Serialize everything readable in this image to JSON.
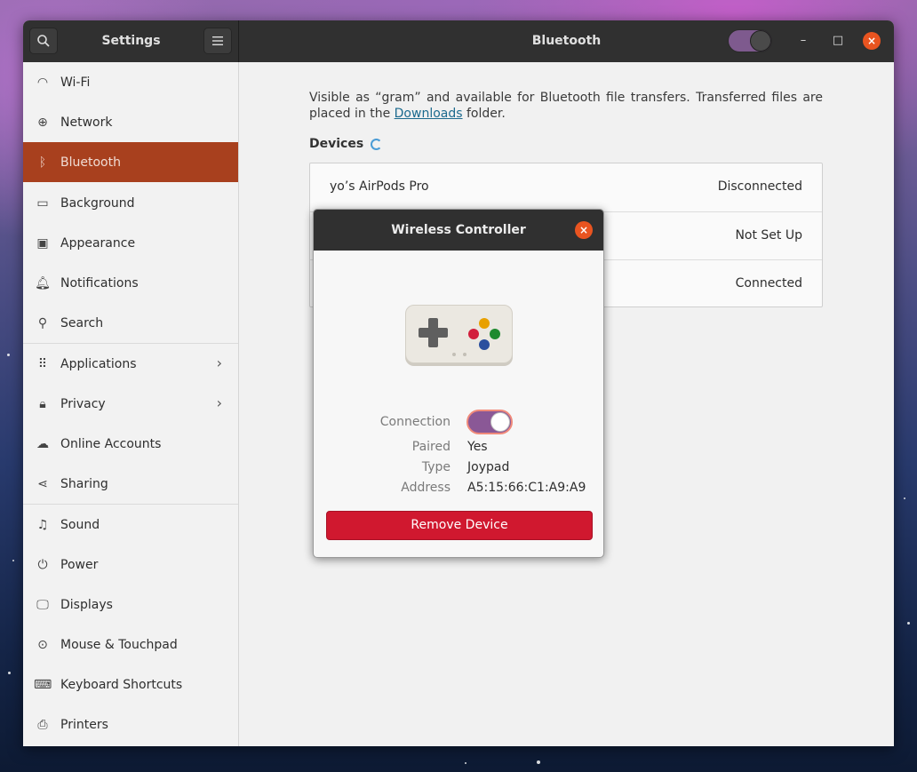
{
  "window": {
    "sidebar_title": "Settings",
    "page_title": "Bluetooth",
    "search_icon": "search-icon",
    "menu_icon": "hamburger-menu-icon",
    "bluetooth_enabled": true,
    "controls": {
      "minimize": "–",
      "maximize": "□",
      "close": "×"
    }
  },
  "sidebar": {
    "items": [
      {
        "label": "Wi-Fi",
        "icon": "wifi-icon",
        "glyph": "◠"
      },
      {
        "label": "Network",
        "icon": "network-icon",
        "glyph": "⊕"
      },
      {
        "label": "Bluetooth",
        "icon": "bluetooth-icon",
        "glyph": "ᛒ"
      },
      {
        "label": "Background",
        "icon": "background-icon",
        "glyph": "▭"
      },
      {
        "label": "Appearance",
        "icon": "appearance-icon",
        "glyph": "▣"
      },
      {
        "label": "Notifications",
        "icon": "bell-icon",
        "glyph": "🔔︎"
      },
      {
        "label": "Search",
        "icon": "search-icon",
        "glyph": "⚲"
      },
      {
        "label": "Applications",
        "icon": "apps-grid-icon",
        "glyph": "⠿"
      },
      {
        "label": "Privacy",
        "icon": "lock-icon",
        "glyph": "🔒︎"
      },
      {
        "label": "Online Accounts",
        "icon": "cloud-icon",
        "glyph": "☁"
      },
      {
        "label": "Sharing",
        "icon": "share-icon",
        "glyph": "⋖"
      },
      {
        "label": "Sound",
        "icon": "music-note-icon",
        "glyph": "♫"
      },
      {
        "label": "Power",
        "icon": "power-icon",
        "glyph": "⏻"
      },
      {
        "label": "Displays",
        "icon": "display-icon",
        "glyph": "🖵︎"
      },
      {
        "label": "Mouse & Touchpad",
        "icon": "mouse-icon",
        "glyph": "⊙"
      },
      {
        "label": "Keyboard Shortcuts",
        "icon": "keyboard-icon",
        "glyph": "⌨"
      },
      {
        "label": "Printers",
        "icon": "printer-icon",
        "glyph": "⎙"
      }
    ],
    "arrow": "›"
  },
  "main": {
    "description_prefix": "Visible as “gram” and available for Bluetooth file transfers. Transferred files are placed in the ",
    "downloads_link": "Downloads",
    "description_suffix": " folder.",
    "devices_heading": "Devices",
    "devices": [
      {
        "name": "yo’s AirPods Pro",
        "status": "Disconnected"
      },
      {
        "name": "",
        "status": "Not Set Up"
      },
      {
        "name": "",
        "status": "Connected"
      }
    ]
  },
  "dialog": {
    "title": "Wireless Controller",
    "close": "×",
    "device_icon": "gamepad-icon",
    "connection_label": "Connection",
    "connection_on": true,
    "paired_label": "Paired",
    "paired_value": "Yes",
    "type_label": "Type",
    "type_value": "Joypad",
    "address_label": "Address",
    "address_value": "A5:15:66:C1:A9:A9",
    "remove_button": "Remove Device"
  },
  "colors": {
    "accent": "#e95420",
    "sidebar_active": "#a8401e",
    "toggle_on": "#8a5896",
    "destructive": "#d0182f",
    "gamepad_buttons": [
      "#e8a000",
      "#d21f3c",
      "#1e8a2e",
      "#2b4f9e"
    ]
  }
}
